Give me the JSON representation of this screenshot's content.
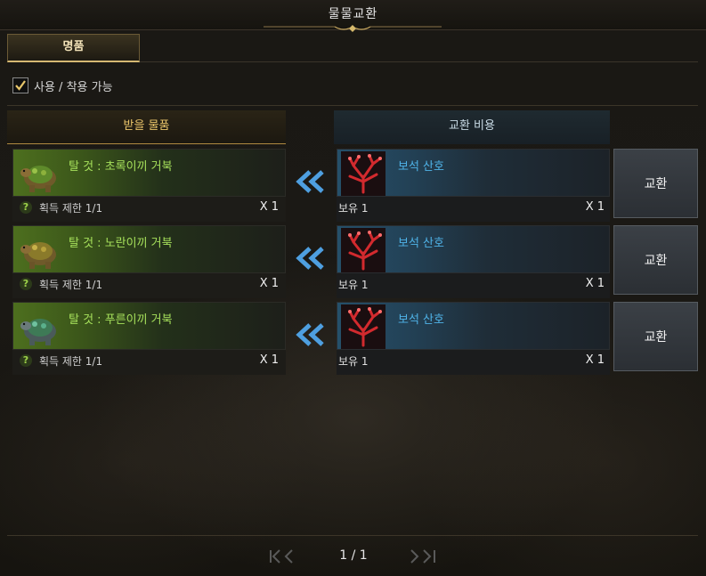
{
  "window": {
    "title": "물물교환"
  },
  "tabs": [
    {
      "label": "명품",
      "active": true
    }
  ],
  "filter": {
    "label": "사용 / 착용 가능",
    "checked": true
  },
  "headers": {
    "receive": "받을 물품",
    "cost": "교환 비용"
  },
  "rows": [
    {
      "receive": {
        "name": "탈 것 : 초록이끼 거북",
        "limit": "획득 제한 1/1",
        "qty": "X 1",
        "icon": "green-moss-turtle-mount-icon"
      },
      "cost": {
        "name": "보석 산호",
        "own": "보유 1",
        "qty": "X 1",
        "icon": "jewel-coral-icon"
      },
      "button": "교환"
    },
    {
      "receive": {
        "name": "탈 것 : 노란이끼 거북",
        "limit": "획득 제한 1/1",
        "qty": "X 1",
        "icon": "yellow-moss-turtle-mount-icon"
      },
      "cost": {
        "name": "보석 산호",
        "own": "보유 1",
        "qty": "X 1",
        "icon": "jewel-coral-icon"
      },
      "button": "교환"
    },
    {
      "receive": {
        "name": "탈 것 : 푸른이끼 거북",
        "limit": "획득 제한 1/1",
        "qty": "X 1",
        "icon": "blue-moss-turtle-mount-icon"
      },
      "cost": {
        "name": "보석 산호",
        "own": "보유 1",
        "qty": "X 1",
        "icon": "jewel-coral-icon"
      },
      "button": "교환"
    }
  ],
  "pagination": {
    "label": "1 / 1"
  },
  "colors": {
    "receive_name": "#a6e05b",
    "cost_name": "#4fb3e8",
    "tab_accent": "#d5b872"
  }
}
